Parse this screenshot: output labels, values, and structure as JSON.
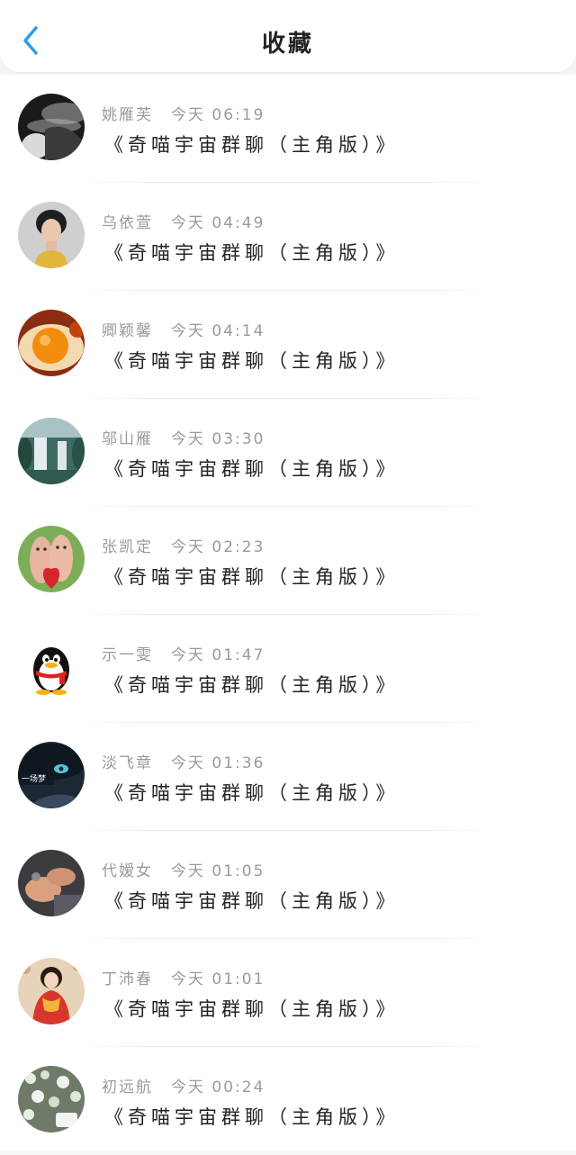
{
  "header": {
    "title": "收藏",
    "back_icon": "chevron-left-icon",
    "accent_color": "#2f9ee6"
  },
  "favorites": [
    {
      "name": "姚雁芙",
      "time": "今天 06:19",
      "message": "《奇喵宇宙群聊（主角版）》",
      "avatar": "smoke-portrait"
    },
    {
      "name": "乌依萱",
      "time": "今天 04:49",
      "message": "《奇喵宇宙群聊（主角版）》",
      "avatar": "woman-portrait"
    },
    {
      "name": "卿颖馨",
      "time": "今天 04:14",
      "message": "《奇喵宇宙群聊（主角版）》",
      "avatar": "egg-yolk"
    },
    {
      "name": "邬山雁",
      "time": "今天 03:30",
      "message": "《奇喵宇宙群聊（主角版）》",
      "avatar": "waterfall"
    },
    {
      "name": "张凯定",
      "time": "今天 02:23",
      "message": "《奇喵宇宙群聊（主角版）》",
      "avatar": "peanut-couple-heart"
    },
    {
      "name": "示一雯",
      "time": "今天 01:47",
      "message": "《奇喵宇宙群聊（主角版）》",
      "avatar": "penguin"
    },
    {
      "name": "淡飞章",
      "time": "今天 01:36",
      "message": "《奇喵宇宙群聊（主角版）》",
      "avatar": "anime-face",
      "avatar_text": "一场梦"
    },
    {
      "name": "代嫒女",
      "time": "今天 01:05",
      "message": "《奇喵宇宙群聊（主角版）》",
      "avatar": "hands"
    },
    {
      "name": "丁沛春",
      "time": "今天 01:01",
      "message": "《奇喵宇宙群聊（主角版）》",
      "avatar": "girl-red-dress"
    },
    {
      "name": "初远航",
      "time": "今天 00:24",
      "message": "《奇喵宇宙群聊（主角版）》",
      "avatar": "flower-field"
    }
  ]
}
